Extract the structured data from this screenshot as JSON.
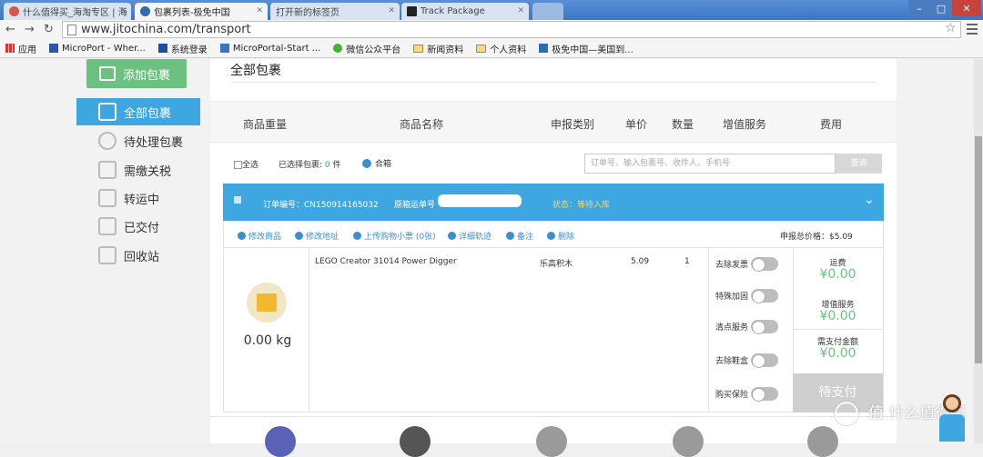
{
  "browser": {
    "tabs": [
      {
        "label": "什么值得买_海淘专区 | 海",
        "icon_color": "#d9534f"
      },
      {
        "label": "包裹列表-极免中国",
        "icon_color": "#2f6db3"
      },
      {
        "label": "打开新的标签页",
        "icon_color": "#bbbbbb"
      },
      {
        "label": "Track Package",
        "icon_color": "#222222"
      }
    ],
    "url": "www.jitochina.com/transport",
    "bookmarks": [
      {
        "label": "应用",
        "icon": "apps-icon"
      },
      {
        "label": "MicroPort - Wher...",
        "icon": "microport-icon"
      },
      {
        "label": "系统登录",
        "icon": "k-icon"
      },
      {
        "label": "MicroPortal-Start ...",
        "icon": "portal-icon"
      },
      {
        "label": "微信公众平台",
        "icon": "wechat-icon"
      },
      {
        "label": "新闻资料",
        "icon": "folder-icon"
      },
      {
        "label": "个人资料",
        "icon": "folder-icon"
      },
      {
        "label": "极免中国—美国到...",
        "icon": "plane-icon"
      }
    ]
  },
  "sidebar": {
    "add_button": "添加包裹",
    "items": [
      {
        "label": "全部包裹",
        "icon": "box-icon"
      },
      {
        "label": "待处理包裹",
        "icon": "clock-icon"
      },
      {
        "label": "需缴关税",
        "icon": "yen-icon"
      },
      {
        "label": "转运中",
        "icon": "arrow-icon"
      },
      {
        "label": "已交付",
        "icon": "check-icon"
      },
      {
        "label": "回收站",
        "icon": "trash-icon"
      }
    ]
  },
  "main": {
    "title": "全部包裹",
    "columns": [
      "商品重量",
      "商品名称",
      "申报类别",
      "单价",
      "数量",
      "增值服务",
      "费用"
    ],
    "filter": {
      "select_all": "全选",
      "selected_label": "已选择包裹:",
      "selected_count": "0",
      "selected_unit": "件",
      "merge": "合箱",
      "search_placeholder": "订单号、输入包裹号、收件人、手机号",
      "search_button": "查询"
    },
    "order": {
      "order_no_label": "订单编号：CN150914165032",
      "tracking_label": "原箱运单号",
      "status": "状态：等待入库"
    },
    "actions": [
      {
        "label": "修改商品",
        "icon": "edit-icon"
      },
      {
        "label": "修改地址",
        "icon": "location-icon"
      },
      {
        "label": "上传购物小票 (0张)",
        "icon": "upload-icon"
      },
      {
        "label": "详细轨迹",
        "icon": "track-icon"
      },
      {
        "label": "备注",
        "icon": "info-icon"
      },
      {
        "label": "删除",
        "icon": "delete-icon"
      }
    ],
    "declared_total": "申报总价格：$5.09",
    "item": {
      "weight": "0.00 kg",
      "name": "LEGO Creator 31014 Power Digger",
      "category": "乐高积木",
      "price": "5.09",
      "qty": "1"
    },
    "services": [
      "去除发票",
      "特殊加固",
      "清点服务",
      "去除鞋盒",
      "购买保险"
    ],
    "fees": {
      "shipping_label": "运费",
      "shipping_value": "¥0.00",
      "service_label": "增值服务",
      "service_value": "¥0.00",
      "due_label": "需支付金额",
      "due_value": "¥0.00",
      "pay_button": "待支付"
    }
  },
  "watermark": "值 什么值得买",
  "colors": {
    "accent": "#3ea7e2",
    "green": "#6cc181"
  }
}
